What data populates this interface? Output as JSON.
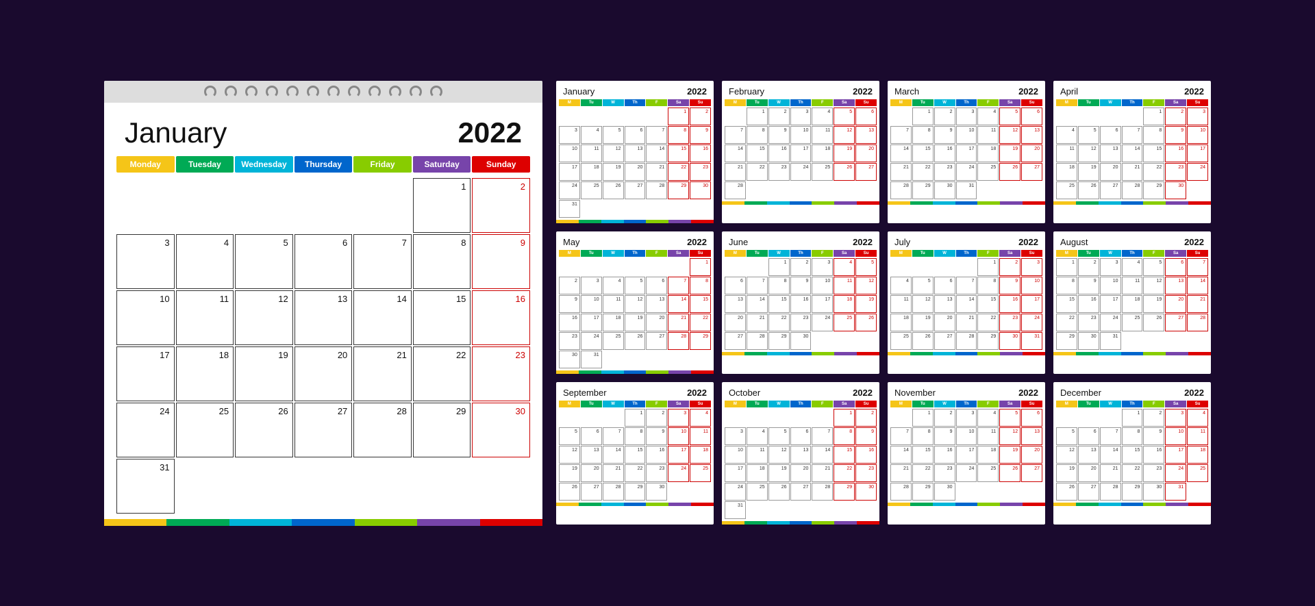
{
  "large": {
    "month": "January",
    "year": "2022",
    "days": [
      "Monday",
      "Tuesday",
      "Wednesday",
      "Thursday",
      "Friday",
      "Saturday",
      "Sunday"
    ],
    "dayColors": [
      "#f5c518",
      "#00aa55",
      "#00b4d8",
      "#0066cc",
      "#88cc00",
      "#7744aa",
      "#dd0000"
    ],
    "cells": [
      {
        "num": "",
        "empty": true
      },
      {
        "num": "",
        "empty": true
      },
      {
        "num": "",
        "empty": true
      },
      {
        "num": "",
        "empty": true
      },
      {
        "num": "",
        "empty": true
      },
      {
        "num": "1",
        "weekend": false
      },
      {
        "num": "2",
        "weekend": true
      },
      {
        "num": "3"
      },
      {
        "num": "4"
      },
      {
        "num": "5"
      },
      {
        "num": "6"
      },
      {
        "num": "7"
      },
      {
        "num": "8",
        "weekend": false
      },
      {
        "num": "9",
        "weekend": true
      },
      {
        "num": "10"
      },
      {
        "num": "11"
      },
      {
        "num": "12"
      },
      {
        "num": "13"
      },
      {
        "num": "14"
      },
      {
        "num": "15",
        "weekend": false
      },
      {
        "num": "16",
        "weekend": true
      },
      {
        "num": "17"
      },
      {
        "num": "18"
      },
      {
        "num": "19"
      },
      {
        "num": "20"
      },
      {
        "num": "21"
      },
      {
        "num": "22",
        "weekend": false
      },
      {
        "num": "23",
        "weekend": true
      },
      {
        "num": "24"
      },
      {
        "num": "25"
      },
      {
        "num": "26"
      },
      {
        "num": "27"
      },
      {
        "num": "28"
      },
      {
        "num": "29",
        "weekend": false
      },
      {
        "num": "30",
        "weekend": true
      },
      {
        "num": "31"
      },
      {
        "num": "",
        "empty": true
      },
      {
        "num": "",
        "empty": true
      },
      {
        "num": "",
        "empty": true
      },
      {
        "num": "",
        "empty": true
      },
      {
        "num": "",
        "empty": true
      },
      {
        "num": "",
        "empty": true
      }
    ]
  },
  "months": [
    {
      "name": "January",
      "year": "2022",
      "startDay": 5,
      "days": 31
    },
    {
      "name": "February",
      "year": "2022",
      "startDay": 1,
      "days": 28
    },
    {
      "name": "March",
      "year": "2022",
      "startDay": 1,
      "days": 31
    },
    {
      "name": "April",
      "year": "2022",
      "startDay": 4,
      "days": 30
    },
    {
      "name": "May",
      "year": "2022",
      "startDay": 6,
      "days": 31
    },
    {
      "name": "June",
      "year": "2022",
      "startDay": 2,
      "days": 30
    },
    {
      "name": "July",
      "year": "2022",
      "startDay": 4,
      "days": 31
    },
    {
      "name": "August",
      "year": "2022",
      "startDay": 0,
      "days": 31
    },
    {
      "name": "September",
      "year": "2022",
      "startDay": 3,
      "days": 30
    },
    {
      "name": "October",
      "year": "2022",
      "startDay": 5,
      "days": 31
    },
    {
      "name": "November",
      "year": "2022",
      "startDay": 1,
      "days": 30
    },
    {
      "name": "December",
      "year": "2022",
      "startDay": 3,
      "days": 31
    }
  ],
  "dayAbbr": [
    "M",
    "Tu",
    "W",
    "Th",
    "F",
    "Sa",
    "Su"
  ],
  "colors": [
    "#f5c518",
    "#00aa55",
    "#00b4d8",
    "#0066cc",
    "#88cc00",
    "#7744aa",
    "#dd0000"
  ]
}
